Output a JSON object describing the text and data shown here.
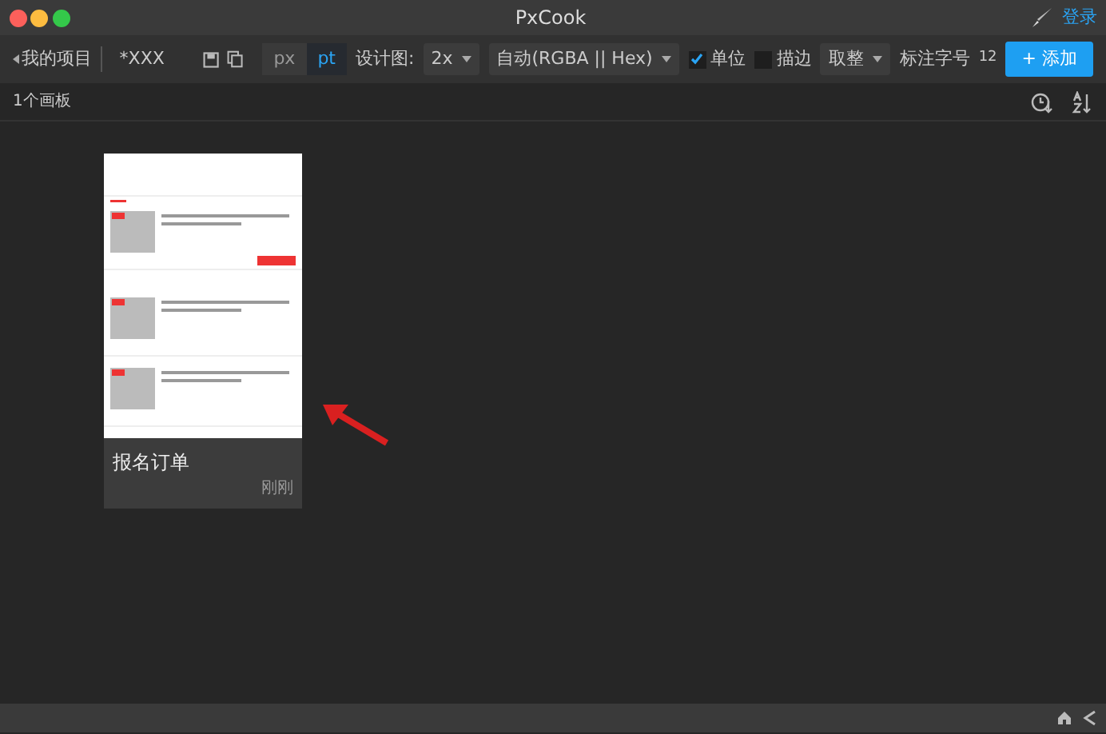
{
  "window": {
    "title": "PxCook",
    "login": "登录"
  },
  "toolbar": {
    "back": "我的项目",
    "project": "*XXX",
    "units": [
      {
        "label": "px",
        "selected": false
      },
      {
        "label": "pt",
        "selected": true
      }
    ],
    "design_label": "设计图:",
    "design_scale": "2x",
    "color_format": "自动(RGBA || Hex)",
    "checks": [
      {
        "label": "单位",
        "checked": true
      },
      {
        "label": "描边",
        "checked": false
      }
    ],
    "rounding": "取整",
    "font_size_label": "标注字号",
    "font_size": "12",
    "add_button": "+ 添加"
  },
  "subbar": {
    "count": "1个画板"
  },
  "boards": [
    {
      "name": "报名订单",
      "time": "刚刚"
    }
  ]
}
